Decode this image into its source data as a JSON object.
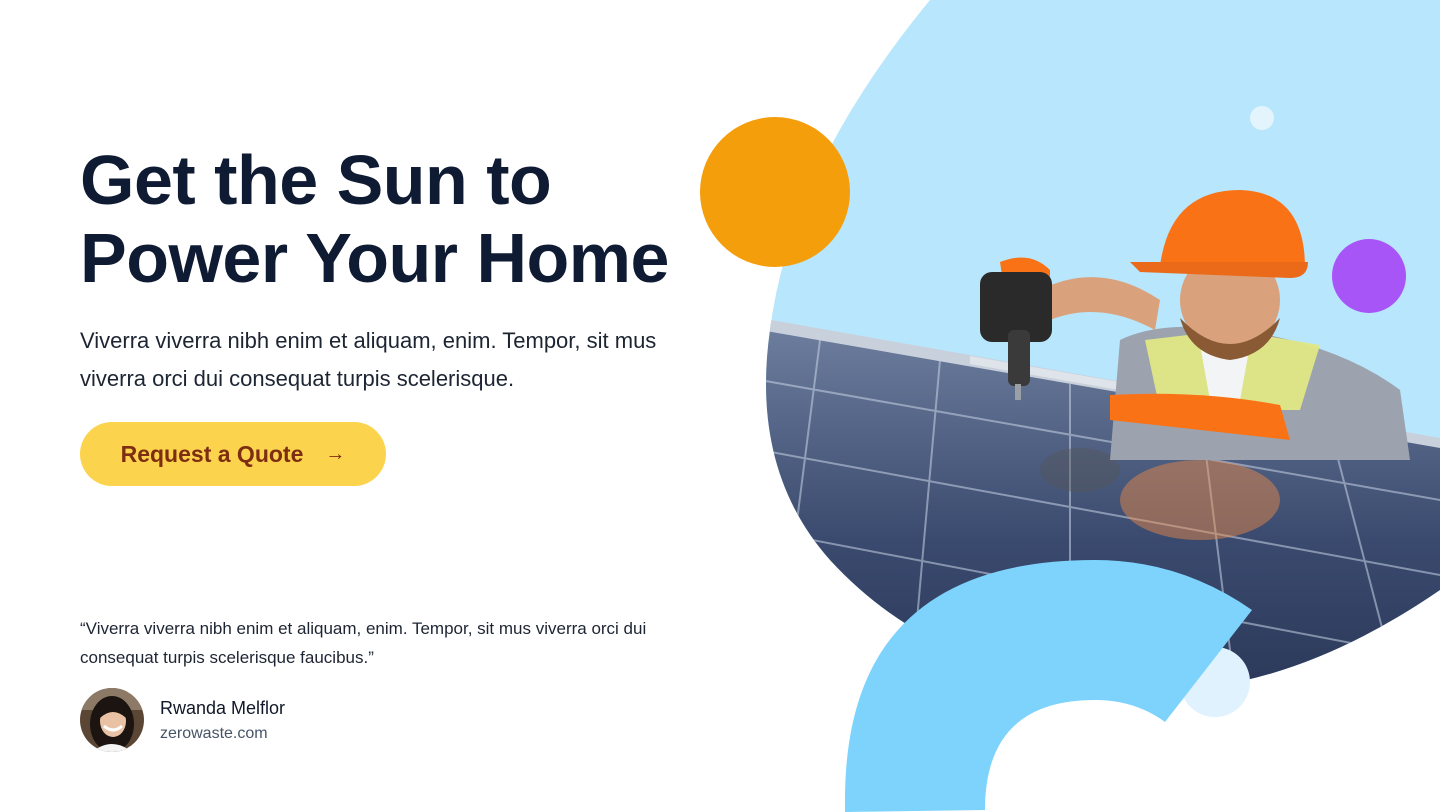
{
  "hero": {
    "headline_line1": "Get the Sun to",
    "headline_line2": "Power Your Home",
    "subtext": "Viverra viverra nibh enim et aliquam, enim. Tempor, sit mus viverra orci dui consequat turpis scelerisque.",
    "cta_label": "Request a Quote",
    "cta_arrow": "→"
  },
  "testimonial": {
    "quote": "“Viverra viverra nibh enim et aliquam, enim. Tempor, sit mus viverra orci dui consequat turpis scelerisque faucibus.”",
    "author_name": "Rwanda Melflor",
    "author_site": "zerowaste.com"
  },
  "colors": {
    "headline": "#0f1a33",
    "cta_bg": "#fcd34d",
    "cta_text": "#7c2d12",
    "sky_blob": "#b8e6fc",
    "orange_circle": "#f59e0b",
    "purple_circle": "#a855f7",
    "arc_blue": "#7dd3fc"
  },
  "icons": {
    "cta": "arrow-right-icon"
  }
}
